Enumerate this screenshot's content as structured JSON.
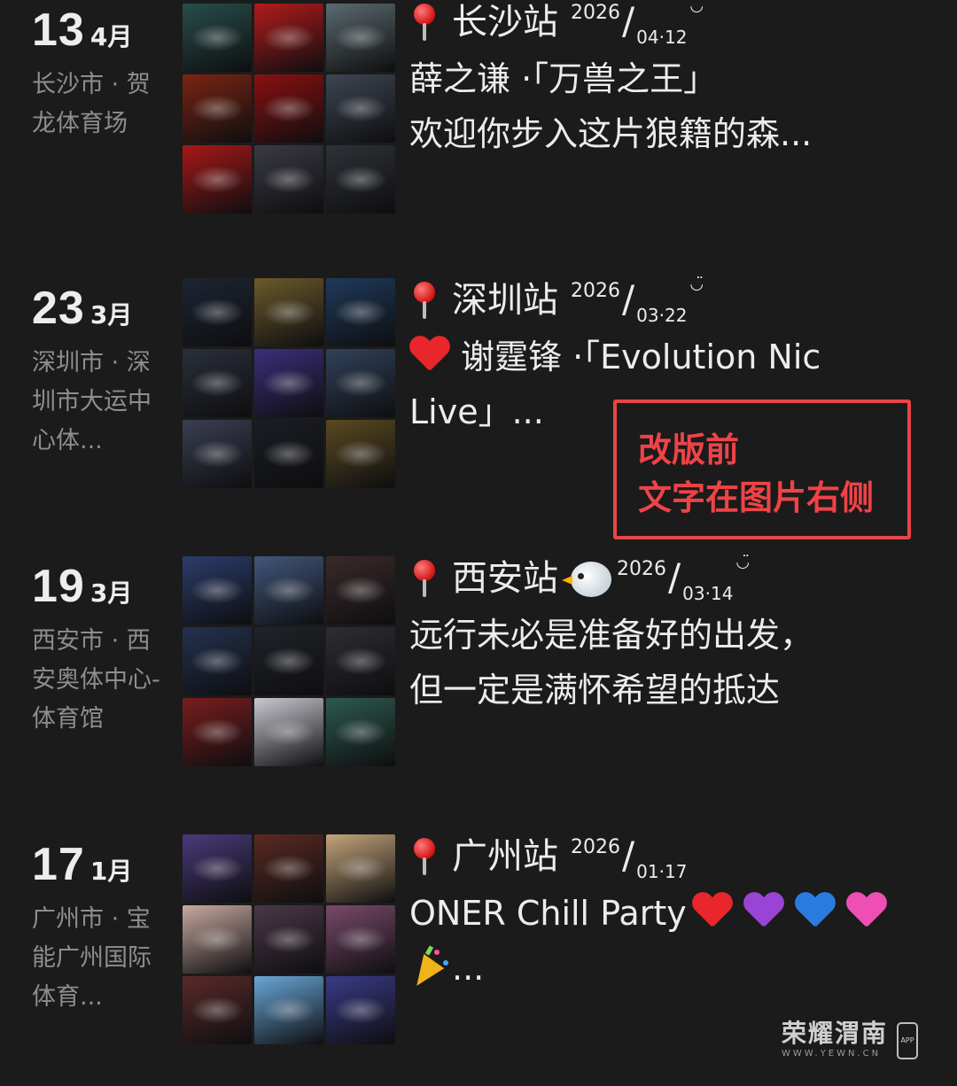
{
  "entries": [
    {
      "day": "13",
      "month": "4月",
      "venue": "长沙市 · 贺龙体育场",
      "station": "长沙站",
      "year": "2026",
      "slash": "/",
      "md": "04·12",
      "smile": "◡̈",
      "lines": [
        "薛之谦 ·「万兽之王」",
        "欢迎你步入这片狼籍的森..."
      ],
      "icon": "pin-icon"
    },
    {
      "day": "23",
      "month": "3月",
      "venue": "深圳市 · 深圳市大运中心体...",
      "station": "深圳站",
      "year": "2026",
      "slash": "/",
      "md": "03·22",
      "smile": "◡̈",
      "lines": [
        "谢霆锋 ·「Evolution Nic",
        "Live」..."
      ],
      "icon": "pin-icon"
    },
    {
      "day": "19",
      "month": "3月",
      "venue": "西安市 · 西安奥体中心-体育馆",
      "station": "西安站",
      "year": "2026",
      "slash": "/",
      "md": "03·14",
      "smile": "◡̈",
      "lines": [
        "远行未必是准备好的出发，",
        "但一定是满怀希望的抵达"
      ],
      "icon": "pin-icon"
    },
    {
      "day": "17",
      "month": "1月",
      "venue": "广州市 · 宝能广州国际体育...",
      "station": "广州站",
      "year": "2026",
      "slash": "/",
      "md": "01·17",
      "smile": "",
      "lines": [
        "ONER Chill Party",
        "..."
      ],
      "icon": "pin-icon"
    }
  ],
  "annotation": {
    "line1": "改版前",
    "line2": "文字在图片右侧",
    "color": "#e84548"
  },
  "watermark": {
    "title": "荣耀渭南",
    "sub": "WWW.YEWN.CN",
    "badge": "APP"
  },
  "heart_colors": {
    "red": "#e8262b",
    "purple": "#9a44d6",
    "blue": "#2a7be0",
    "pink": "#ef4fb4"
  },
  "thumb_palettes": [
    [
      "#274e4a",
      "#b31b1b",
      "#5c6a70",
      "#7a2512",
      "#8a1010",
      "#3d4652",
      "#a81818",
      "#3a3a45",
      "#2e3238"
    ],
    [
      "#1d2533",
      "#6b5a2b",
      "#1f3a5a",
      "#2a2f3a",
      "#3b2f7a",
      "#31425a",
      "#3a3f52",
      "#1a1d24",
      "#5a4a22"
    ],
    [
      "#2c3d6b",
      "#42577a",
      "#3a2a2a",
      "#24324f",
      "#20232a",
      "#2d2d33",
      "#7a1d1d",
      "#c9c9d1",
      "#2d5a4e"
    ],
    [
      "#4a3a7a",
      "#5a2a22",
      "#c4a47a",
      "#c8a9a0",
      "#4a3848",
      "#7a4a6a",
      "#5a2a2a",
      "#6aa6d8",
      "#3a3a88"
    ]
  ]
}
